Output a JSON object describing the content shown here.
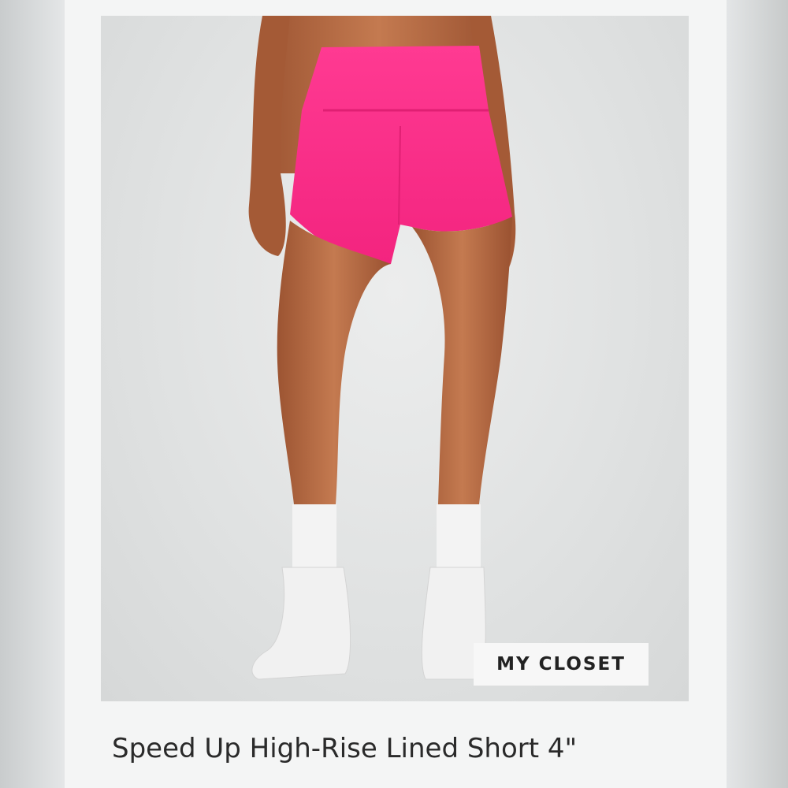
{
  "product": {
    "title": "Speed Up High-Rise Lined Short 4\"",
    "badge": "MY CLOSET",
    "image_label": "product-photo"
  },
  "colors": {
    "shorts": "#ff2d8c",
    "background": "#e0e2e2",
    "skin": "#b86a44",
    "socks": "#f3f3f3"
  }
}
